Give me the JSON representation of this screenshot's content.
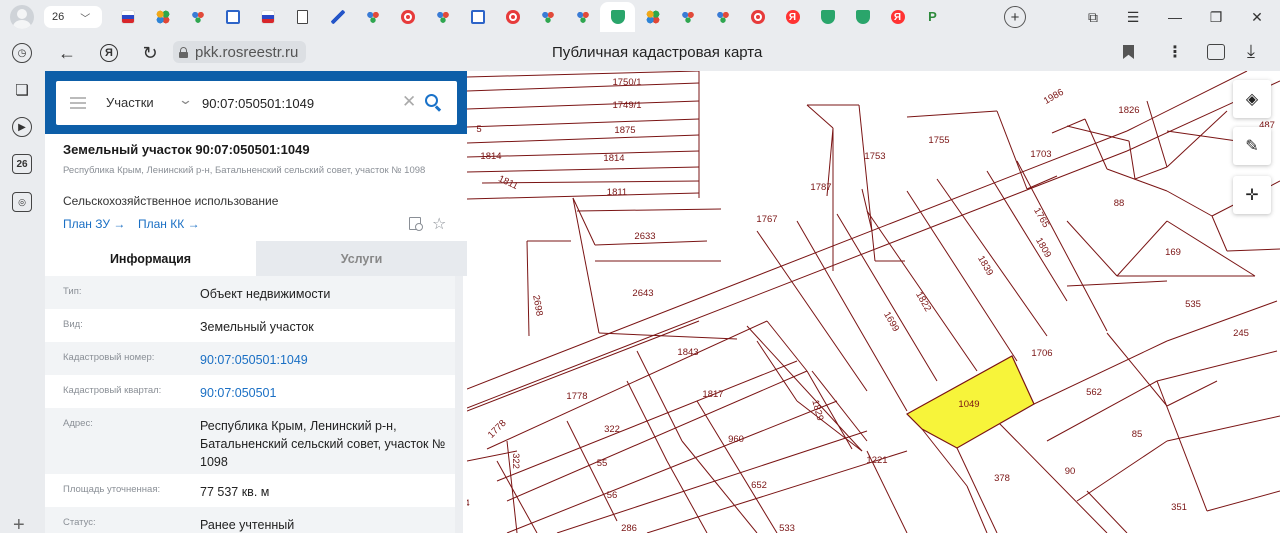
{
  "browser": {
    "tab_count": "26",
    "tabs": [
      {
        "icon": "flag-icon"
      },
      {
        "icon": "flower-icon"
      },
      {
        "icon": "dots-icon"
      },
      {
        "icon": "mail-icon"
      },
      {
        "icon": "flag-icon"
      },
      {
        "icon": "document-icon"
      },
      {
        "icon": "mark-icon"
      },
      {
        "icon": "dots-icon"
      },
      {
        "icon": "red-circle-icon"
      },
      {
        "icon": "dots-icon"
      },
      {
        "icon": "mail-icon"
      },
      {
        "icon": "red-circle-icon"
      },
      {
        "icon": "dots-icon"
      },
      {
        "icon": "dots-icon"
      },
      {
        "icon": "rosreestr-icon",
        "active": true
      },
      {
        "icon": "flower-icon"
      },
      {
        "icon": "dots-icon"
      },
      {
        "icon": "dots-icon"
      },
      {
        "icon": "red-circle-icon"
      },
      {
        "icon": "yandex-icon"
      },
      {
        "icon": "rosreestr-icon"
      },
      {
        "icon": "rosreestr-icon"
      },
      {
        "icon": "yandex-icon"
      },
      {
        "icon": "p-icon"
      }
    ],
    "sidebar_badge": "26",
    "ya_letter": "Я",
    "url": "pkk.rosreestr.ru",
    "page_title": "Публичная кадастровая карта"
  },
  "search": {
    "type_label": "Участки",
    "query": "90:07:050501:1049"
  },
  "object": {
    "title": "Земельный участок 90:07:050501:1049",
    "address_small": "Республика Крым, Ленинский р-н, Батальненский сельский совет, участок № 1098",
    "usage": "Сельскохозяйственное использование",
    "plan_zu": "План ЗУ →",
    "plan_kk": "План КК →"
  },
  "tabs": {
    "info": "Информация",
    "services": "Услуги"
  },
  "info_rows": [
    {
      "label": "Тип:",
      "value": "Объект недвижимости",
      "link": false
    },
    {
      "label": "Вид:",
      "value": "Земельный участок",
      "link": false
    },
    {
      "label": "Кадастровый номер:",
      "value": "90:07:050501:1049",
      "link": true
    },
    {
      "label": "Кадастровый квартал:",
      "value": "90:07:050501",
      "link": true
    },
    {
      "label": "Адрес:",
      "value": "Республика Крым, Ленинский р-н, Батальненский сельский совет, участок № 1098",
      "link": false
    },
    {
      "label": "Площадь уточненная:",
      "value": "77 537 кв. м",
      "link": false
    },
    {
      "label": "Статус:",
      "value": "Ранее учтенный",
      "link": false
    }
  ],
  "map": {
    "parcel_color": "#7a1414",
    "highlight_color": "#f7f43a",
    "labels": [
      "1750/1",
      "1749/1",
      "1875",
      "5",
      "1814",
      "1814",
      "1811",
      "1811",
      "2633",
      "2643",
      "2698",
      "1767",
      "1787",
      "1753",
      "1755",
      "1986",
      "1826",
      "487",
      "1703",
      "88",
      "169",
      "535",
      "245",
      "1765",
      "1809",
      "1839",
      "1822",
      "1699",
      "1706",
      "562",
      "85",
      "1049",
      "1843",
      "1817",
      "1778",
      "1778",
      "322",
      "322",
      "55",
      "56",
      "286",
      "960",
      "652",
      "533",
      "1829",
      "1221",
      "378",
      "90",
      "351",
      "4"
    ]
  },
  "colors": {
    "accent": "#0d5ea8",
    "link": "#1a6fc4"
  }
}
